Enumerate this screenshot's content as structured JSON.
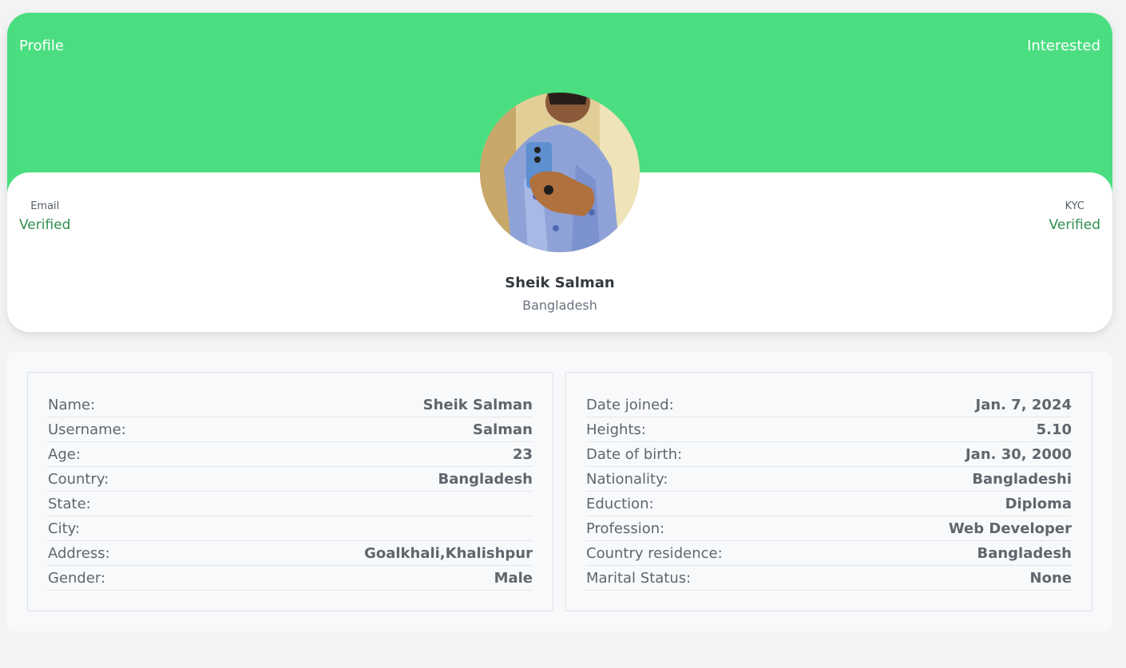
{
  "header": {
    "profile_link": "Profile",
    "interested_link": "Interested",
    "banner_color": "#4ade80"
  },
  "status": {
    "email_label": "Email",
    "email_value": "Verified",
    "kyc_label": "KYC",
    "kyc_value": "Verified",
    "verified_color": "#2f8f4e"
  },
  "user": {
    "name": "Sheik Salman",
    "country": "Bangladesh"
  },
  "details_left": [
    {
      "label": "Name:",
      "value": "Sheik Salman"
    },
    {
      "label": "Username:",
      "value": "Salman"
    },
    {
      "label": "Age:",
      "value": "23"
    },
    {
      "label": "Country:",
      "value": "Bangladesh"
    },
    {
      "label": "State:",
      "value": ""
    },
    {
      "label": "City:",
      "value": ""
    },
    {
      "label": "Address:",
      "value": "Goalkhali,Khalishpur"
    },
    {
      "label": "Gender:",
      "value": "Male"
    }
  ],
  "details_right": [
    {
      "label": "Date joined:",
      "value": "Jan. 7, 2024"
    },
    {
      "label": "Heights:",
      "value": "5.10"
    },
    {
      "label": "Date of birth:",
      "value": "Jan. 30, 2000"
    },
    {
      "label": "Nationality:",
      "value": "Bangladeshi"
    },
    {
      "label": "Eduction:",
      "value": "Diploma"
    },
    {
      "label": "Profession:",
      "value": "Web Developer"
    },
    {
      "label": "Country residence:",
      "value": "Bangladesh"
    },
    {
      "label": "Marital Status:",
      "value": "None"
    }
  ]
}
